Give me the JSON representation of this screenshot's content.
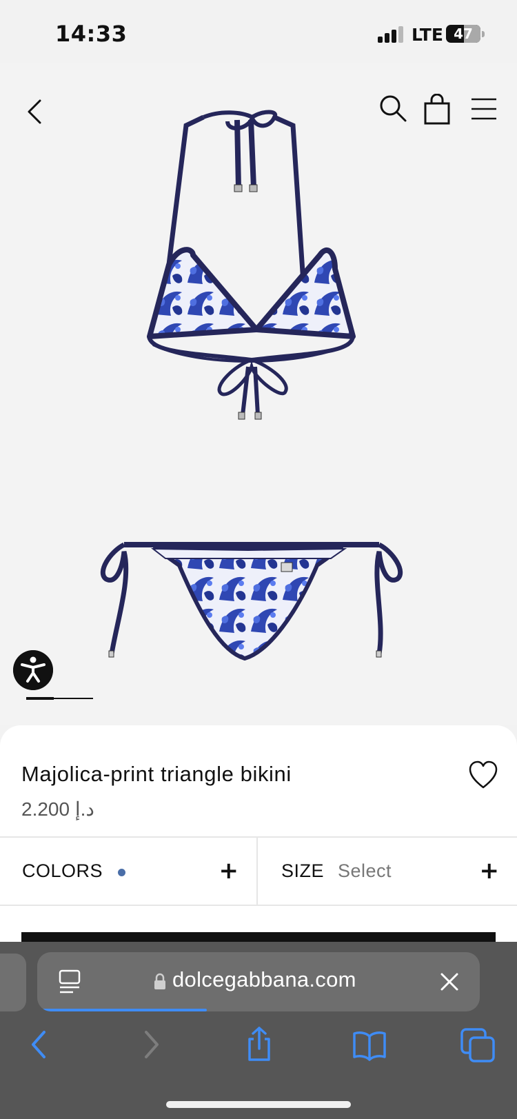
{
  "status_bar": {
    "time": "14:33",
    "network": "LTE",
    "battery": "47"
  },
  "header": {
    "icons": [
      "chevron-left-icon",
      "search-icon",
      "bag-icon",
      "menu-icon"
    ]
  },
  "product": {
    "title": "Majolica-print triangle bikini",
    "price": "2.200 د.إ",
    "colors_label": "COLORS",
    "selected_color": "#4a6ea8",
    "size_label": "SIZE",
    "size_value": "Select",
    "expand_symbol": "+",
    "carousel": {
      "current": 1
    }
  },
  "browser": {
    "url": "dolcegabbana.com",
    "load_progress": 0.37,
    "accent_color": "#3f8cf5"
  }
}
